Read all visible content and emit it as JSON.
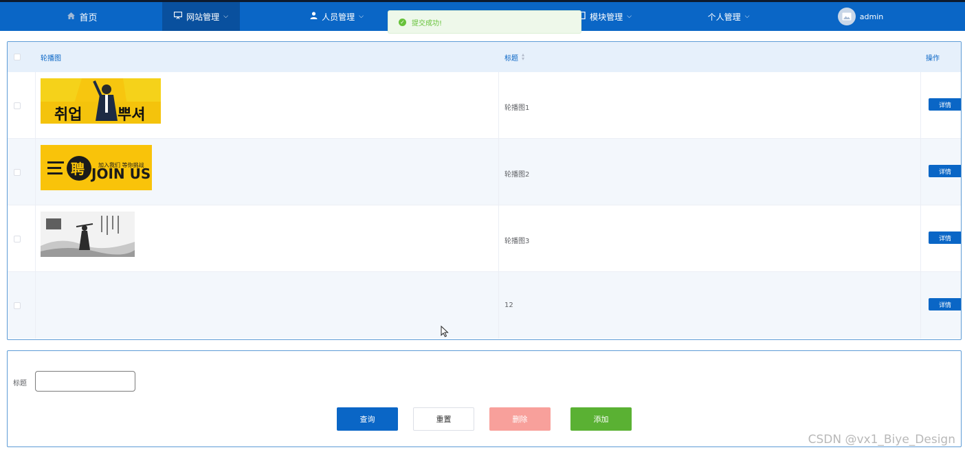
{
  "nav": {
    "items": [
      {
        "label": "首页",
        "icon": "home-icon"
      },
      {
        "label": "网站管理",
        "icon": "monitor-icon"
      },
      {
        "label": "人员管理",
        "icon": "user-icon"
      },
      {
        "label": "模块管理",
        "icon": "module-icon"
      },
      {
        "label": "个人管理",
        "icon": "none"
      }
    ],
    "user": "admin",
    "accent": "#0a66c6"
  },
  "toast": {
    "text": "提交成功!",
    "color": "#67c23a"
  },
  "table": {
    "headers": {
      "image": "轮播图",
      "title": "标题",
      "action": "操作"
    },
    "rows": [
      {
        "title": "轮播图1",
        "image": "banner-employment",
        "action": "详情"
      },
      {
        "title": "轮播图2",
        "image": "banner-join-us",
        "action": "详情"
      },
      {
        "title": "轮播图3",
        "image": "banner-ink-painting",
        "action": "详情"
      },
      {
        "title": "12",
        "image": "",
        "action": "详情"
      }
    ],
    "banner2_text": {
      "join": "JOIN US",
      "sub": "加入我们 等你挑战"
    }
  },
  "search": {
    "label": "标题",
    "value": "",
    "buttons": {
      "query": "查询",
      "reset": "重置",
      "delete": "删除",
      "add": "添加"
    },
    "colors": {
      "query": "#0a66c6",
      "delete": "#f8a09b",
      "add": "#5ab133"
    }
  },
  "watermark": "CSDN @vx1_Biye_Design"
}
